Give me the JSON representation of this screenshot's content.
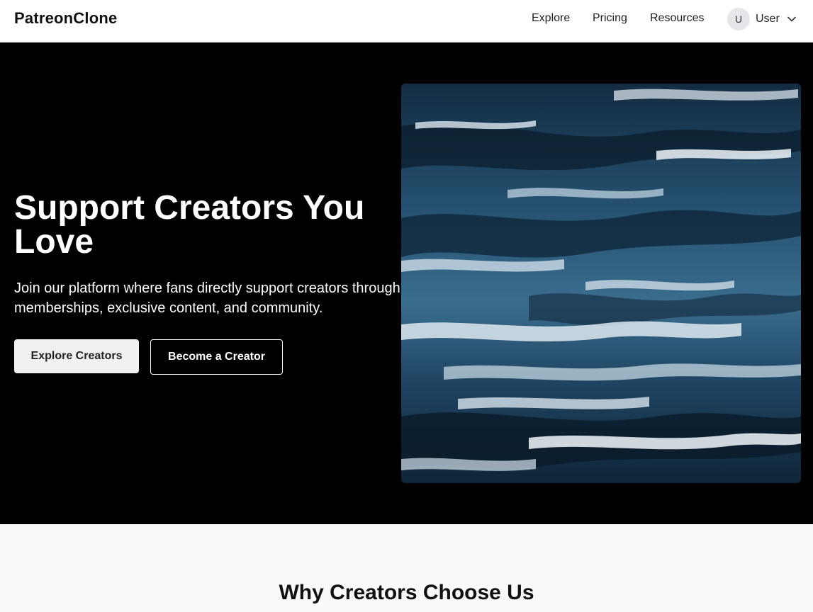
{
  "header": {
    "logo": "PatreonClone",
    "nav": {
      "explore": "Explore",
      "pricing": "Pricing",
      "resources": "Resources"
    },
    "user": {
      "avatar_initial": "U",
      "name": "User",
      "menu_icon": "chevron-down-icon"
    }
  },
  "hero": {
    "title": "Support Creators You Love",
    "subtitle": "Join our platform where fans directly support creators through memberships, exclusive content, and community.",
    "primary_button": "Explore Creators",
    "secondary_button": "Become a Creator",
    "image": "abstract-blue-ocean-painting"
  },
  "features": {
    "title": "Why Creators Choose Us"
  },
  "colors": {
    "hero_background": "#000000",
    "primary_button_bg": "#f1f1f4",
    "section_background": "#f8f9fb"
  }
}
